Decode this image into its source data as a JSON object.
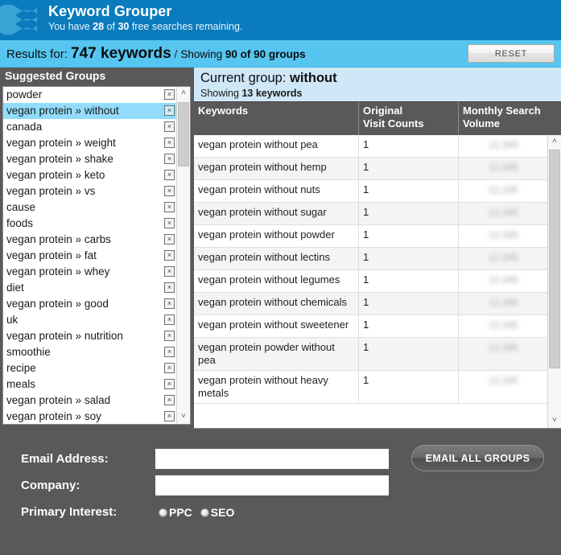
{
  "brand": {
    "app_title": "Keyword Grouper",
    "quota_prefix": "You have ",
    "quota_used": "28",
    "quota_mid": " of ",
    "quota_total": "30",
    "quota_suffix": " free searches remaining.",
    "logo_icon": "wave-logo-icon",
    "bar_color": "#0a7bbd"
  },
  "results": {
    "lead_label": "Results for: ",
    "keyword_count": "747 keywords",
    "separator": " / ",
    "showing_prefix": "Showing ",
    "showing_value": "90 of 90 groups",
    "reset_label": "RESET",
    "bar_color": "#56c5f0"
  },
  "groups": {
    "header": "Suggested Groups",
    "delete_icon": "×",
    "selected_index": 1,
    "items": [
      "powder",
      "vegan protein » without",
      "canada",
      "vegan protein » weight",
      "vegan protein » shake",
      "vegan protein » keto",
      "vegan protein » vs",
      "cause",
      "foods",
      "vegan protein » carbs",
      "vegan protein » fat",
      "vegan protein » whey",
      "diet",
      "vegan protein » good",
      "uk",
      "vegan protein » nutrition",
      "smoothie",
      "recipe",
      "meals",
      "vegan protein » salad",
      "vegan protein » soy"
    ],
    "scroll_up_icon": "˄",
    "scroll_down_icon": "˅"
  },
  "current_group": {
    "title_prefix": "Current group: ",
    "title_value": "without",
    "subtitle_prefix": "Showing ",
    "subtitle_value": "13 keywords",
    "banner_color": "#cfe7f7"
  },
  "table": {
    "columns": [
      "Keywords",
      "Original Visit Counts",
      "Monthly Search Volume"
    ],
    "column_keywords": "Keywords",
    "column_visits_line1": "Original",
    "column_visits_line2": "Visit Counts",
    "column_volume_line1": "Monthly Search",
    "column_volume_line2": "Volume",
    "obscured_value": "12,345",
    "rows": [
      {
        "keyword": "vegan protein without pea",
        "visits": "1",
        "volume": "12,345"
      },
      {
        "keyword": "vegan protein without hemp",
        "visits": "1",
        "volume": "12,345"
      },
      {
        "keyword": "vegan protein without nuts",
        "visits": "1",
        "volume": "12,345"
      },
      {
        "keyword": "vegan protein without sugar",
        "visits": "1",
        "volume": "12,345"
      },
      {
        "keyword": "vegan protein without powder",
        "visits": "1",
        "volume": "12,345"
      },
      {
        "keyword": "vegan protein without lectins",
        "visits": "1",
        "volume": "12,345"
      },
      {
        "keyword": "vegan protein without legumes",
        "visits": "1",
        "volume": "12,345"
      },
      {
        "keyword": "vegan protein without chemicals",
        "visits": "1",
        "volume": "12,345"
      },
      {
        "keyword": "vegan protein without sweetener",
        "visits": "1",
        "volume": "12,345"
      },
      {
        "keyword": "vegan protein powder without pea",
        "visits": "1",
        "volume": "12,345"
      },
      {
        "keyword": "vegan protein without heavy metals",
        "visits": "1",
        "volume": "12,345"
      }
    ]
  },
  "form": {
    "email_label": "Email Address:",
    "email_value": "",
    "company_label": "Company:",
    "company_value": "",
    "interest_label": "Primary Interest:",
    "option_ppc": "PPC",
    "option_seo": "SEO",
    "submit_label": "EMAIL ALL GROUPS",
    "panel_color": "#595959"
  }
}
